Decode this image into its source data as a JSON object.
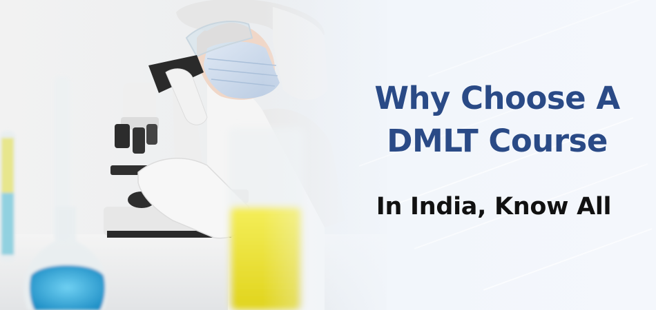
{
  "banner": {
    "headline_line1": "Why Choose A",
    "headline_line2": "DMLT Course",
    "subheadline": "In India, Know All"
  },
  "colors": {
    "headline": "#2a4a86",
    "subheadline": "#111111",
    "background": "#f4f7fb"
  },
  "image": {
    "subject": "lab-technician-with-microscope"
  }
}
